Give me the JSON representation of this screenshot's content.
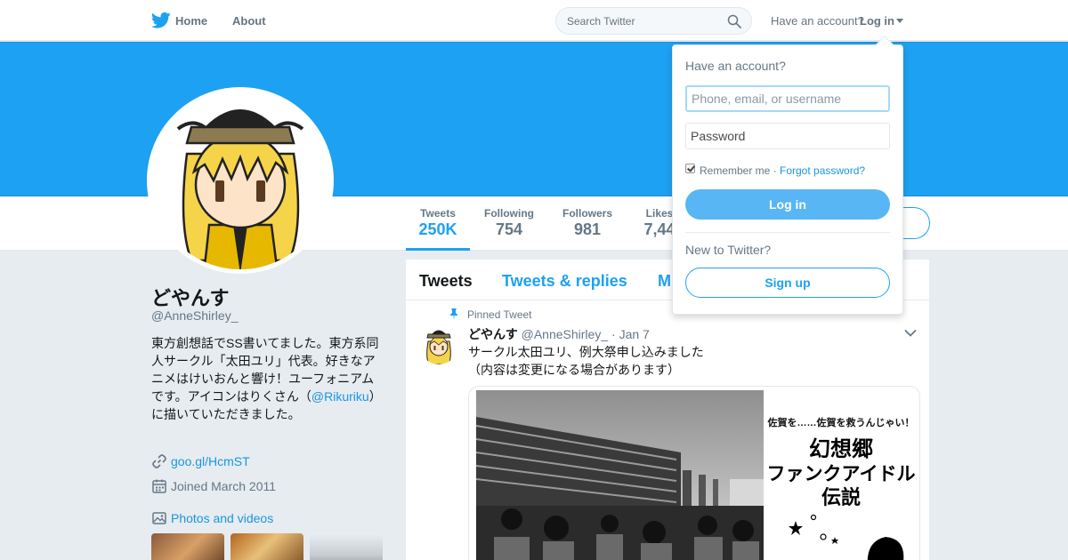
{
  "colors": {
    "brand": "#1da1f2",
    "link": "#1b95e0",
    "text": "#14171a",
    "secondary_text": "#657786",
    "page_background": "#e6ecf0",
    "banner": "#1da1f2"
  },
  "icons": {
    "logo": "twitter-bird-icon",
    "search": "search-icon",
    "caret": "caret-down-icon",
    "link": "link-icon",
    "calendar": "calendar-icon",
    "photo": "photo-icon",
    "pin": "pin-icon",
    "tweet_menu": "chevron-down-icon"
  },
  "nav": {
    "home": "Home",
    "about": "About",
    "search_placeholder": "Search Twitter",
    "have_account": "Have an account?",
    "login": "Log in"
  },
  "profile": {
    "display_name": "どやんす",
    "screen_name": "@AnneShirley_",
    "bio_before": "東方創想話でSS書いてました。東方系同人サークル「太田ユリ」代表。好きなアニメはけいおんと響け！ユーフォニアムです。アイコンはりくさん（",
    "bio_mention": "@Rikuriku",
    "bio_after": "）に描いていただきました。",
    "url": "goo.gl/HcmST",
    "joined": "Joined March 2011",
    "photos_label": "Photos and videos"
  },
  "stats": [
    {
      "label": "Tweets",
      "value": "250K"
    },
    {
      "label": "Following",
      "value": "754"
    },
    {
      "label": "Followers",
      "value": "981"
    },
    {
      "label": "Likes",
      "value": "7,44"
    }
  ],
  "timeline": {
    "tabs": [
      "Tweets",
      "Tweets & replies",
      "M"
    ],
    "pinned_label": "Pinned Tweet",
    "tweet": {
      "name": "どやんす",
      "handle": "@AnneShirley_",
      "date": "· Jan 7",
      "text_line1": "サークル太田ユリ、例大祭申し込みました",
      "text_line2": "（内容は変更になる場合があります）"
    },
    "flyer": {
      "top": "佐賀を……佐賀を救うんじゃい！",
      "line1": "幻想郷",
      "line2": "ファンクアイドル",
      "line3": "伝説"
    }
  },
  "login_dropdown": {
    "heading": "Have an account?",
    "username_placeholder": "Phone, email, or username",
    "password_placeholder": "Password",
    "remember_me": "Remember me",
    "separator": "·",
    "forgot": "Forgot password?",
    "login_button": "Log in",
    "new_to_twitter": "New to Twitter?",
    "signup_button": "Sign up"
  }
}
